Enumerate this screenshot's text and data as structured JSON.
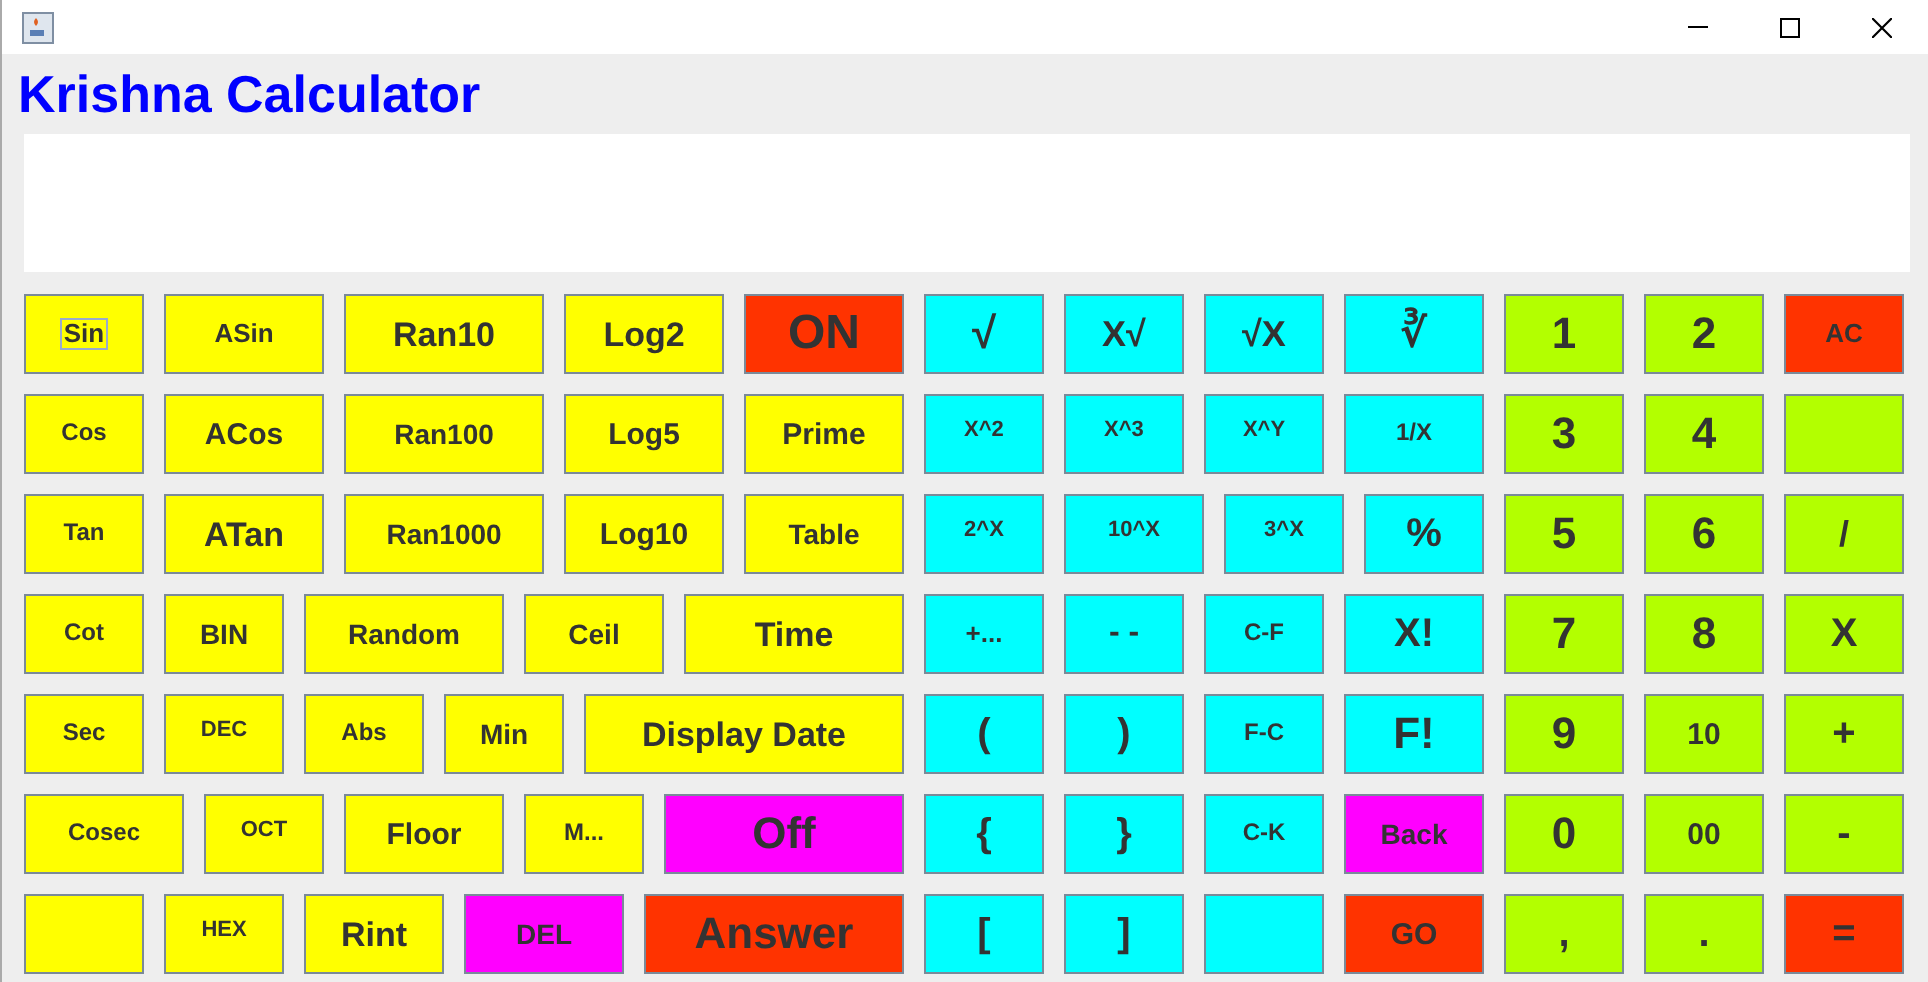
{
  "heading": "Krishna Calculator",
  "keypad": {
    "rows": [
      [
        {
          "label": "Sin",
          "color": "#ffff00",
          "focused": true
        },
        {
          "label": "ASin",
          "color": "#ffff00",
          "focused": false
        },
        {
          "label": "Ran10",
          "color": "#ffff00",
          "focused": false
        },
        {
          "label": "Log2",
          "color": "#ffff00",
          "focused": false
        },
        {
          "label": "ON",
          "color": "#ff3300",
          "focused": false
        },
        {
          "label": "√",
          "color": "#00ffff",
          "focused": false
        },
        {
          "label": "X√",
          "color": "#00ffff",
          "focused": false
        },
        {
          "label": "√X",
          "color": "#00ffff",
          "focused": false
        },
        {
          "label": "∛",
          "color": "#00ffff",
          "focused": false
        },
        {
          "label": "1",
          "color": "#b3ff00",
          "focused": false
        },
        {
          "label": "2",
          "color": "#b3ff00",
          "focused": false
        },
        {
          "label": "AC",
          "color": "#ff3300",
          "focused": false
        }
      ],
      [
        {
          "label": "Cos",
          "color": "#ffff00",
          "focused": false
        },
        {
          "label": "ACos",
          "color": "#ffff00",
          "focused": false
        },
        {
          "label": "Ran100",
          "color": "#ffff00",
          "focused": false
        },
        {
          "label": "Log5",
          "color": "#ffff00",
          "focused": false
        },
        {
          "label": "Prime",
          "color": "#ffff00",
          "focused": false
        },
        {
          "label": "X^2",
          "color": "#00ffff",
          "focused": false
        },
        {
          "label": "X^3",
          "color": "#00ffff",
          "focused": false
        },
        {
          "label": "X^Y",
          "color": "#00ffff",
          "focused": false
        },
        {
          "label": "1/X",
          "color": "#00ffff",
          "focused": false
        },
        {
          "label": "3",
          "color": "#b3ff00",
          "focused": false
        },
        {
          "label": "4",
          "color": "#b3ff00",
          "focused": false
        },
        {
          "color": "#b3ff00",
          "focused": false
        }
      ],
      [
        {
          "label": "Tan",
          "color": "#ffff00",
          "focused": false
        },
        {
          "label": "ATan",
          "color": "#ffff00",
          "focused": false
        },
        {
          "label": "Ran1000",
          "color": "#ffff00",
          "focused": false
        },
        {
          "label": "Log10",
          "color": "#ffff00",
          "focused": false
        },
        {
          "label": "Table",
          "color": "#ffff00",
          "focused": false
        },
        {
          "label": "2^X",
          "color": "#00ffff",
          "focused": false
        },
        {
          "label": "10^X",
          "color": "#00ffff",
          "focused": false
        },
        {
          "label": "3^X",
          "color": "#00ffff",
          "focused": false
        },
        {
          "label": "%",
          "color": "#00ffff",
          "focused": false
        },
        {
          "label": "5",
          "color": "#b3ff00",
          "focused": false
        },
        {
          "label": "6",
          "color": "#b3ff00",
          "focused": false
        },
        {
          "label": "/",
          "color": "#b3ff00",
          "focused": false
        }
      ],
      [
        {
          "label": "Cot",
          "color": "#ffff00",
          "focused": false
        },
        {
          "label": "BIN",
          "color": "#ffff00",
          "focused": false
        },
        {
          "label": "Random",
          "color": "#ffff00",
          "focused": false
        },
        {
          "label": "Ceil",
          "color": "#ffff00",
          "focused": false
        },
        {
          "label": "Time",
          "color": "#ffff00",
          "focused": false
        },
        {
          "label": "+...",
          "color": "#00ffff",
          "focused": false
        },
        {
          "label": "- -",
          "color": "#00ffff",
          "focused": false
        },
        {
          "label": "C-F",
          "color": "#00ffff",
          "focused": false
        },
        {
          "label": "X!",
          "color": "#00ffff",
          "focused": false
        },
        {
          "label": "7",
          "color": "#b3ff00",
          "focused": false
        },
        {
          "label": "8",
          "color": "#b3ff00",
          "focused": false
        },
        {
          "label": "X",
          "color": "#b3ff00",
          "focused": false
        }
      ],
      [
        {
          "label": "Sec",
          "color": "#ffff00",
          "focused": false
        },
        {
          "label": "DEC",
          "color": "#ffff00",
          "focused": false
        },
        {
          "label": "Abs",
          "color": "#ffff00",
          "focused": false
        },
        {
          "label": "Min",
          "color": "#ffff00",
          "focused": false
        },
        {
          "label": "Display Date",
          "color": "#ffff00",
          "focused": false
        },
        {
          "label": "(",
          "color": "#00ffff",
          "focused": false
        },
        {
          "label": ")",
          "color": "#00ffff",
          "focused": false
        },
        {
          "label": "F-C",
          "color": "#00ffff",
          "focused": false
        },
        {
          "label": "F!",
          "color": "#00ffff",
          "focused": false
        },
        {
          "label": "9",
          "color": "#b3ff00",
          "focused": false
        },
        {
          "label": "10",
          "color": "#b3ff00",
          "focused": false
        },
        {
          "label": "+",
          "color": "#b3ff00",
          "focused": false
        }
      ],
      [
        {
          "label": "Cosec",
          "color": "#ffff00",
          "focused": false
        },
        {
          "label": "OCT",
          "color": "#ffff00",
          "focused": false
        },
        {
          "label": "Floor",
          "color": "#ffff00",
          "focused": false
        },
        {
          "label": "M...",
          "color": "#ffff00",
          "focused": false
        },
        {
          "label": "Off",
          "color": "#ff00ff",
          "focused": false
        },
        {
          "label": "{",
          "color": "#00ffff",
          "focused": false
        },
        {
          "label": "}",
          "color": "#00ffff",
          "focused": false
        },
        {
          "label": "C-K",
          "color": "#00ffff",
          "focused": false
        },
        {
          "label": "Back",
          "color": "#ff00ff",
          "focused": false
        },
        {
          "label": "0",
          "color": "#b3ff00",
          "focused": false
        },
        {
          "label": "00",
          "color": "#b3ff00",
          "focused": false
        },
        {
          "label": "-",
          "color": "#b3ff00",
          "focused": false
        }
      ],
      [
        {
          "color": "#ffff00",
          "focused": false
        },
        {
          "label": "HEX",
          "color": "#ffff00",
          "focused": false
        },
        {
          "label": "Rint",
          "color": "#ffff00",
          "focused": false
        },
        {
          "label": "DEL",
          "color": "#ff00ff",
          "focused": false
        },
        {
          "label": "Answer",
          "color": "#ff3300",
          "focused": false
        },
        {
          "label": "[",
          "color": "#00ffff",
          "focused": false
        },
        {
          "label": "]",
          "color": "#00ffff",
          "focused": false
        },
        {
          "color": "#00ffff",
          "focused": false
        },
        {
          "label": "GO",
          "color": "#ff3300",
          "focused": false
        },
        {
          "label": ",",
          "color": "#b3ff00",
          "focused": false
        },
        {
          "label": ".",
          "color": "#b3ff00",
          "focused": false
        },
        {
          "label": "=",
          "color": "#ff3300",
          "focused": false
        }
      ]
    ]
  }
}
